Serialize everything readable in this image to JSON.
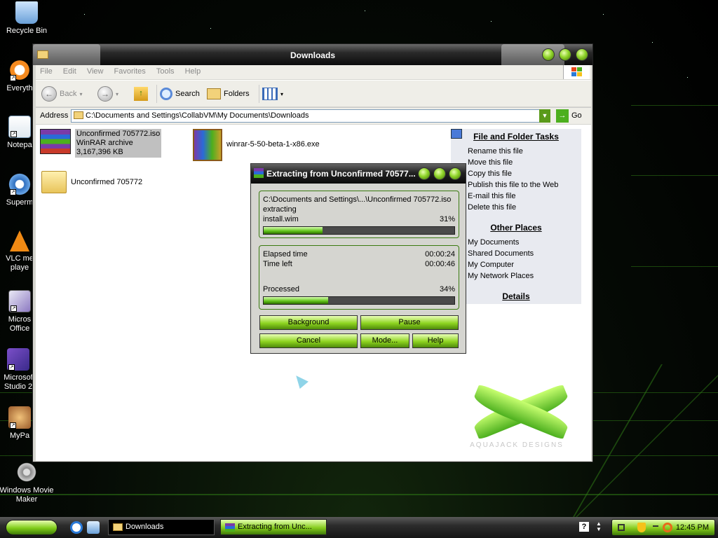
{
  "desktop": {
    "icons": [
      {
        "name": "Recycle Bin",
        "label": "Recycle Bin"
      },
      {
        "name": "Everything",
        "label": "Everyth"
      },
      {
        "name": "Notepad",
        "label": "Notepa"
      },
      {
        "name": "Supermium",
        "label": "Superm"
      },
      {
        "name": "VLC",
        "label": "VLC me\nplaye"
      },
      {
        "name": "Microsoft Office",
        "label": "Micros\nOffice"
      },
      {
        "name": "Microsoft Studio",
        "label": "Microsof\nStudio 2"
      },
      {
        "name": "MyPal",
        "label": "MyPa"
      },
      {
        "name": "Windows Movie Maker",
        "label": "Windows Movie\nMaker"
      }
    ],
    "watermark": "AQUAJACK DESIGNS"
  },
  "explorer": {
    "title": "Downloads",
    "menu": [
      "File",
      "Edit",
      "View",
      "Favorites",
      "Tools",
      "Help"
    ],
    "toolbar": {
      "back": "Back",
      "search": "Search",
      "folders": "Folders"
    },
    "address": {
      "label": "Address",
      "value": "C:\\Documents and Settings\\CollabVM\\My Documents\\Downloads",
      "go": "Go"
    },
    "files": [
      {
        "name": "Unconfirmed 705772.iso",
        "type": "WinRAR archive",
        "size": "3,167,396 KB",
        "selected": true
      },
      {
        "name": "winrar-5-50-beta-1-x86.exe"
      },
      {
        "name": "Unconfirmed 705772"
      }
    ],
    "tasks": {
      "file_heading": "File and Folder Tasks",
      "file_links": [
        "Rename this file",
        "Move this file",
        "Copy this file",
        "Publish this file to the Web",
        "E-mail this file",
        "Delete this file"
      ],
      "other_heading": "Other Places",
      "other_links": [
        "My Documents",
        "Shared Documents",
        "My Computer",
        "My Network Places"
      ],
      "details_heading": "Details"
    }
  },
  "rar": {
    "title": "Extracting from Unconfirmed 70577...",
    "path": "C:\\Documents and Settings\\...\\Unconfirmed 705772.iso",
    "action": "extracting",
    "file": "install.wim",
    "file_percent_text": "31%",
    "file_percent": 31,
    "elapsed_label": "Elapsed time",
    "elapsed": "00:00:24",
    "left_label": "Time left",
    "left": "00:00:46",
    "processed_label": "Processed",
    "processed_percent_text": "34%",
    "processed_percent": 34,
    "buttons": {
      "background": "Background",
      "pause": "Pause",
      "cancel": "Cancel",
      "mode": "Mode...",
      "help": "Help"
    }
  },
  "taskbar": {
    "tasks": [
      {
        "label": "Downloads"
      },
      {
        "label": "Extracting from Unc..."
      }
    ],
    "clock": "12:45 PM"
  },
  "colors": {
    "accent": "#8ed420",
    "title_dark": "#0c0c0c",
    "progress": "#5cc014"
  }
}
